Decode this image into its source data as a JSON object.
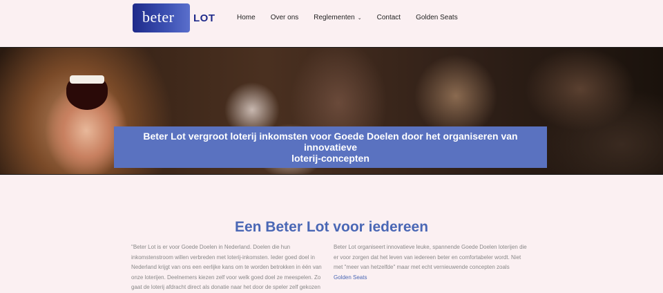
{
  "logo": {
    "word": "beter",
    "suffix": "LOT"
  },
  "nav": [
    {
      "label": "Home"
    },
    {
      "label": "Over ons"
    },
    {
      "label": "Reglementen",
      "has_dropdown": true
    },
    {
      "label": "Contact"
    },
    {
      "label": "Golden Seats"
    }
  ],
  "hero": {
    "headline_line1": "Beter Lot vergroot loterij inkomsten voor Goede Doelen door het organiseren van innovatieve",
    "headline_line2": "loterij-concepten"
  },
  "section": {
    "title": "Een Beter Lot voor iedereen",
    "col1": "\"Beter Lot is er voor Goede Doelen in Nederland. Doelen die hun inkomstenstroom willen verbreden met loterij-inkomsten. Ieder goed doel in Nederland krijgt van ons een eerlijke kans om te worden betrokken in één van onze loterijen. Deelnemers kiezen zelf voor welk goed doel ze meespelen. Zo gaat de loterij afdracht direct als donatie naar het door de speler zelf gekozen",
    "col2_text": "Beter Lot organiseert innovatieve leuke, spannende Goede Doelen loterijen die er voor zorgen dat het leven van iedereen beter en comfortabeler wordt. Niet met \"meer van hetzelfde\" maar met echt vernieuwende concepten zoals ",
    "col2_link": "Golden Seats"
  },
  "colors": {
    "accent": "#4a67b5",
    "banner": "#5a72c0",
    "background": "#fbf0f2",
    "logo_dark": "#1e2a8a"
  }
}
